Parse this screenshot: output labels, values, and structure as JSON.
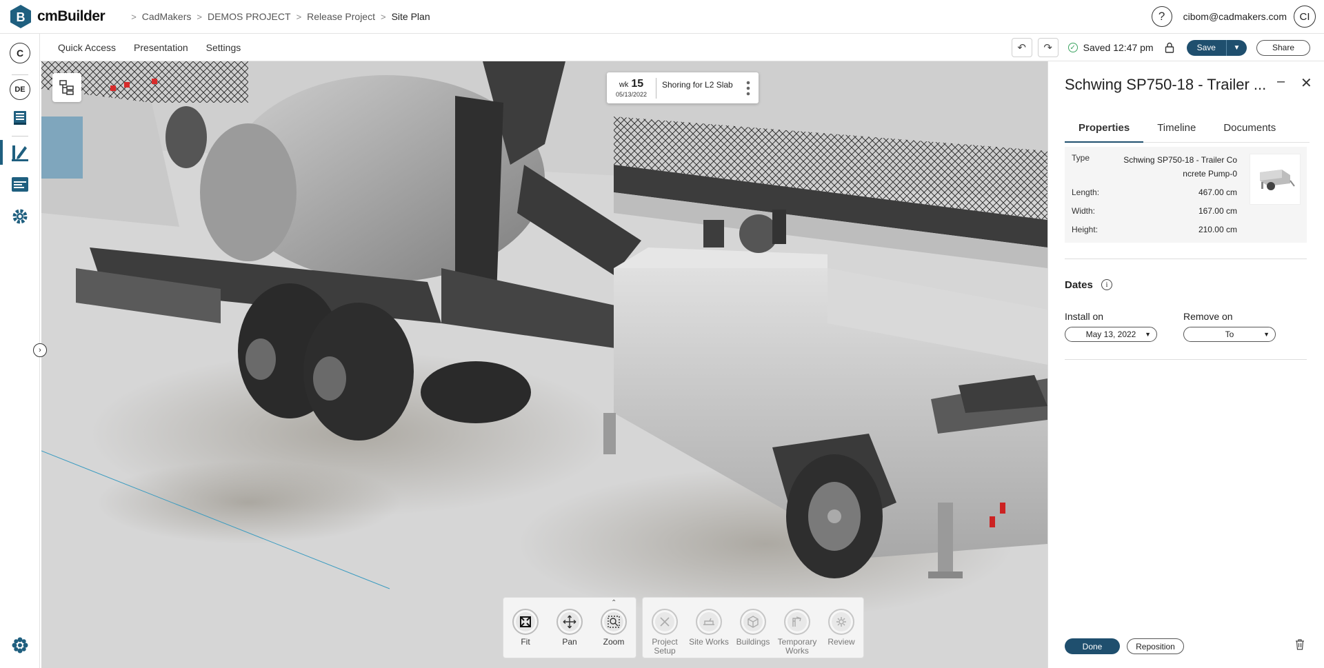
{
  "app": {
    "brand": "cmBuilder"
  },
  "breadcrumb": [
    "CadMakers",
    "DEMOS PROJECT",
    "Release Project",
    "Site Plan"
  ],
  "header": {
    "user_email": "cibom@cadmakers.com",
    "avatar_initials": "CI",
    "help": "?"
  },
  "leftrail": {
    "top_badge": "C",
    "lang_badge": "DE"
  },
  "menubar": {
    "items": [
      "Quick Access",
      "Presentation",
      "Settings"
    ],
    "saved_text": "Saved 12:47 pm",
    "save_label": "Save",
    "share_label": "Share"
  },
  "week_card": {
    "wk_label": "wk",
    "wk_number": "15",
    "date": "05/13/2022",
    "task": "Shoring for L2 Slab"
  },
  "nav_tools": [
    {
      "label": "Fit",
      "icon": "fit-icon"
    },
    {
      "label": "Pan",
      "icon": "pan-icon"
    },
    {
      "label": "Zoom",
      "icon": "zoom-icon"
    }
  ],
  "app_tools": [
    {
      "label": "Project Setup",
      "icon": "project-setup-icon"
    },
    {
      "label": "Site Works",
      "icon": "site-works-icon"
    },
    {
      "label": "Buildings",
      "icon": "buildings-icon"
    },
    {
      "label": "Temporary Works",
      "icon": "temporary-works-icon"
    },
    {
      "label": "Review",
      "icon": "review-icon"
    }
  ],
  "panel": {
    "title": "Schwing SP750-18 - Trailer ...",
    "tabs": [
      "Properties",
      "Timeline",
      "Documents"
    ],
    "active_tab": "Properties",
    "props": {
      "type_label": "Type",
      "type_value": "Schwing SP750-18 - Trailer Co ncrete Pump-0",
      "rows": [
        {
          "label": "Length:",
          "value": "467.00 cm"
        },
        {
          "label": "Width:",
          "value": "167.00 cm"
        },
        {
          "label": "Height:",
          "value": "210.00 cm"
        }
      ]
    },
    "dates_title": "Dates",
    "install_label": "Install on",
    "install_value": "May 13, 2022",
    "remove_label": "Remove on",
    "remove_value": "To",
    "done_label": "Done",
    "reposition_label": "Reposition"
  },
  "colors": {
    "accent": "#1f4f6e",
    "saved_green": "#3aa360",
    "rail_active": "#1f5f7f"
  }
}
